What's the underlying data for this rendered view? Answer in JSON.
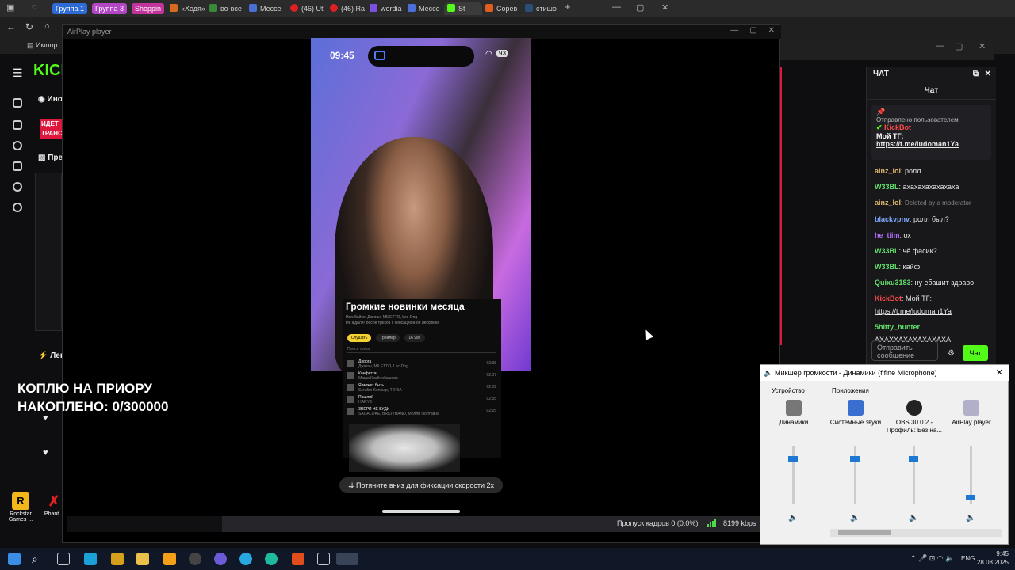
{
  "browser": {
    "groups": [
      "Группа 1",
      "Группа 3",
      "Shoppin"
    ],
    "tabs": [
      "«Ходя»",
      "во-все",
      "Мессе",
      "(46) Ut",
      "(46) Ra",
      "werdia",
      "Мессе",
      "St",
      "Сорев",
      "стишо"
    ],
    "bookmarks": [
      "Импорт"
    ],
    "window_controls": [
      "—",
      "▢",
      "✕"
    ]
  },
  "kick": {
    "logo": "KICK",
    "sidebar_label_1": "Ино",
    "sidebar_label_2": "Пре",
    "sidebar_label_3": "Лен",
    "promo": "ИДЕТ ТРАНС",
    "accent": "#53fc18"
  },
  "chat": {
    "header": "ЧАТ",
    "sub": "Чат",
    "pinned_label": "Отправлено пользователем",
    "pinned_user": "KickBot",
    "pinned_text": "Мой ТГ:",
    "pinned_link": "https://t.me/ludoman1Ya",
    "messages": [
      {
        "user": "ainz_lol",
        "text": "ролл",
        "color": "#e2b96f"
      },
      {
        "user": "W33BL",
        "text": "ахахахахахахаха",
        "color": "#63e06b"
      },
      {
        "user": "ainz_lol",
        "text": "Deleted by a moderator",
        "color": "#e2b96f"
      },
      {
        "user": "blackvpnv",
        "text": "ролл был?",
        "color": "#7ea9ff"
      },
      {
        "user": "he_tiim",
        "text": "ох",
        "color": "#b56cff"
      },
      {
        "user": "W33BL",
        "text": "чё фасик?",
        "color": "#63e06b"
      },
      {
        "user": "W33BL",
        "text": "кайф",
        "color": "#63e06b"
      },
      {
        "user": "Quixu3183",
        "text": "ну ебашит здраво",
        "color": "#63e06b"
      },
      {
        "user": "KickBot",
        "text": "Мой ТГ:",
        "color": "#ff4a4a"
      },
      {
        "user": "",
        "text": "https://t.me/ludoman1Ya",
        "color": "#e6e6e6"
      },
      {
        "user": "5hitty_hunter",
        "text": "",
        "color": "#63e06b"
      },
      {
        "user": "",
        "text": "АХАХХАХАХАХАХАХА",
        "color": "#e6e6e6"
      }
    ],
    "send_placeholder": "Отправить сообщение",
    "send_button": "Чат"
  },
  "airplay": {
    "title": "AirPlay player",
    "controls": [
      "—",
      "▢",
      "✕"
    ],
    "phone": {
      "time": "09:45",
      "battery": "93",
      "card_title": "Громкие новинки месяца",
      "card_sub": "Нагибайся, Джиган, MILETTO, Loc-Dog",
      "card_desc": "Не ждали! Воспе треков с сенсационной лексикой",
      "btn_play": "Слушать",
      "btn_trailer": "Трейлер",
      "btn_likes": "16 987",
      "track_search": "Поиск трека",
      "tracks": [
        {
          "title": "Дорога",
          "artist": "Джиган, MILETTO, Loc-Dog",
          "dur": "02:38"
        },
        {
          "title": "Конфетти",
          "artist": "Маша Крайнобашова",
          "dur": "02:07"
        },
        {
          "title": "Я может быть",
          "artist": "Serafim Kontsap, TORIA",
          "dur": "02:09"
        },
        {
          "title": "Пошлий",
          "artist": "HARYE",
          "dur": "02:35"
        },
        {
          "title": "ЗВЕРЯ НЕ БУДИ",
          "artist": "SAGALOKE, BRIOVHAND, Молли Полтавна",
          "dur": "02:25"
        }
      ],
      "speed_hint": "Потяните вниз для фиксации скорости 2х"
    }
  },
  "overlay": {
    "line1": "КОПЛЮ НА ПРИОРУ",
    "line2": "НАКОПЛЕНО: 0/300000"
  },
  "obs": {
    "dropped_frames": "Пропуск кадров 0 (0.0%)",
    "bitrate": "8199 kbps"
  },
  "mixer": {
    "title": "Микшер громкости - Динамики (fifine Microphone)",
    "device_label": "Устройство",
    "apps_label": "Приложения",
    "columns": [
      {
        "name": "Динамики",
        "level": 0.78
      },
      {
        "name": "Системные звуки",
        "level": 0.78
      },
      {
        "name": "OBS 30.0.2 - Профиль: Без на...",
        "level": 0.78
      },
      {
        "name": "AirPlay player",
        "level": 0.12
      }
    ]
  },
  "desktop": {
    "icon1": "Rockstar Games ...",
    "icon2": "Phant..."
  },
  "taskbar": {
    "lang": "ENG",
    "time": "9:45",
    "date": "28.08.2025"
  }
}
